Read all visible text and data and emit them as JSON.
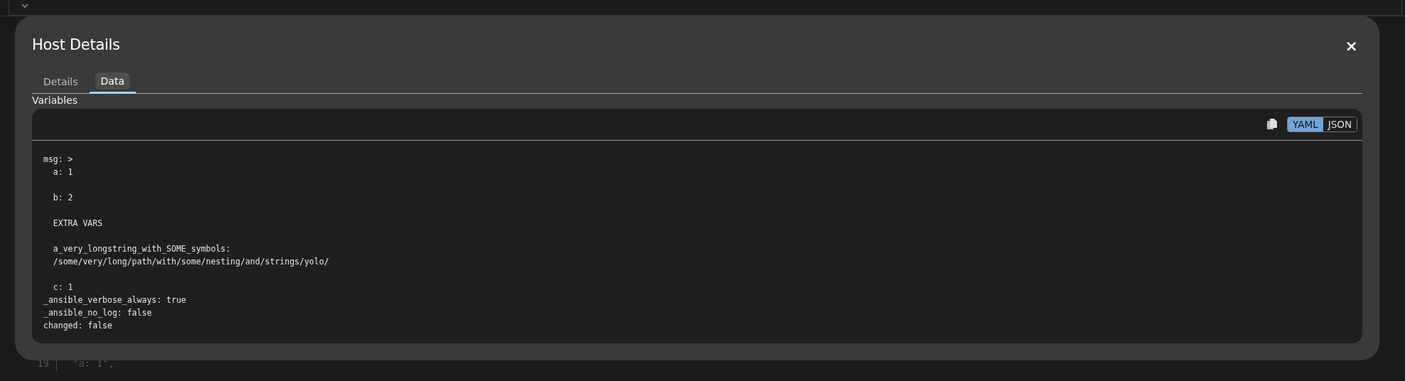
{
  "background_editor": {
    "lines": [
      {
        "number": "19",
        "text": "\"a: 1\","
      }
    ]
  },
  "modal": {
    "title": "Host Details",
    "close": "×",
    "tabs": [
      {
        "label": "Details",
        "selected": false
      },
      {
        "label": "Data",
        "selected": true
      }
    ],
    "section_label": "Variables",
    "format_toggle": [
      {
        "label": "YAML",
        "selected": true
      },
      {
        "label": "JSON",
        "selected": false
      }
    ],
    "code": "msg: >\n  a: 1\n\n  b: 2\n\n  EXTRA VARS\n\n  a_very_longstring_with_SOME_symbols:\n  /some/very/long/path/with/some/nesting/and/strings/yolo/\n\n  c: 1\n_ansible_verbose_always: true\n_ansible_no_log: false\nchanged: false"
  }
}
